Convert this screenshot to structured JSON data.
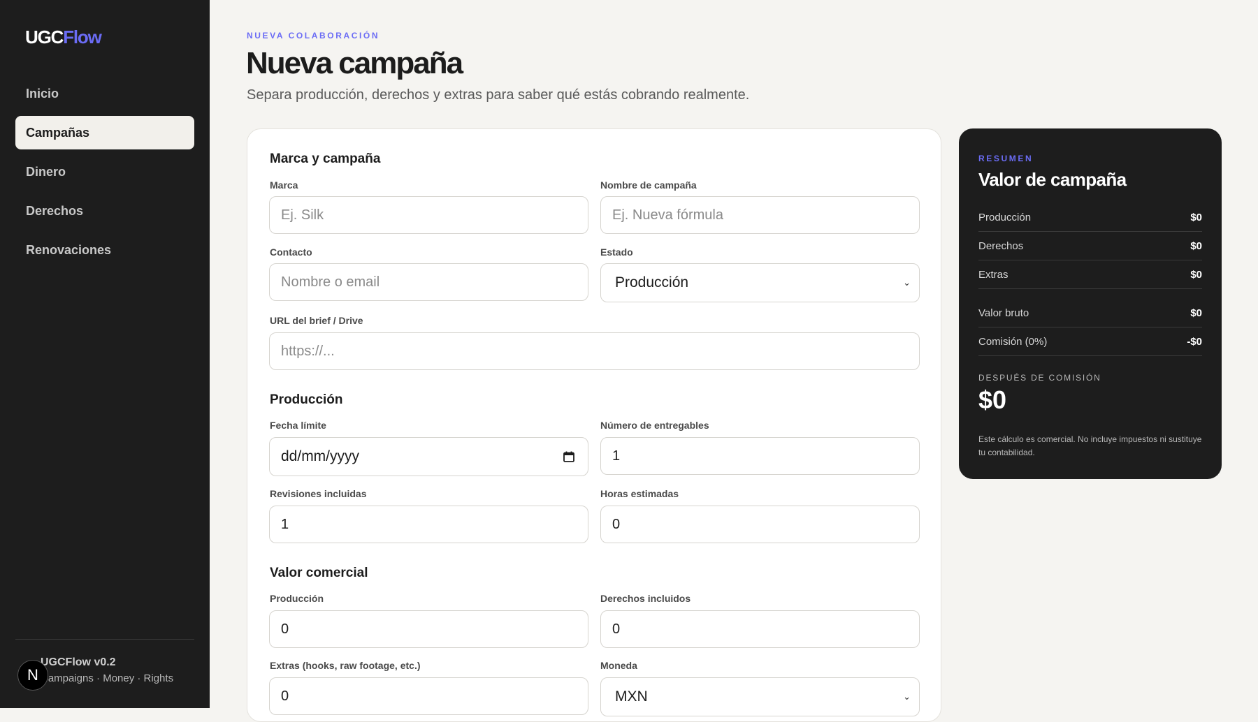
{
  "brand": {
    "part1": "UGC",
    "part2": "Flow"
  },
  "sidebar": {
    "items": [
      {
        "label": "Inicio"
      },
      {
        "label": "Campañas"
      },
      {
        "label": "Dinero"
      },
      {
        "label": "Derechos"
      },
      {
        "label": "Renovaciones"
      }
    ],
    "active_index": 1,
    "version": "UGCFlow v0.2",
    "tagline": "Campaigns · Money · Rights",
    "badge": "N"
  },
  "header": {
    "eyebrow": "NUEVA COLABORACIÓN",
    "title": "Nueva campaña",
    "subtitle": "Separa producción, derechos y extras para saber qué estás cobrando realmente."
  },
  "form": {
    "brand_section": {
      "title": "Marca y campaña",
      "marca": {
        "label": "Marca",
        "placeholder": "Ej. Silk",
        "value": ""
      },
      "nombre": {
        "label": "Nombre de campaña",
        "placeholder": "Ej. Nueva fórmula",
        "value": ""
      },
      "contacto": {
        "label": "Contacto",
        "placeholder": "Nombre o email",
        "value": ""
      },
      "estado": {
        "label": "Estado",
        "value": "Producción"
      },
      "url": {
        "label": "URL del brief / Drive",
        "placeholder": "https://...",
        "value": ""
      }
    },
    "production_section": {
      "title": "Producción",
      "fecha": {
        "label": "Fecha límite",
        "value": "dd/mm/yyyy"
      },
      "entregables": {
        "label": "Número de entregables",
        "value": "1"
      },
      "revisiones": {
        "label": "Revisiones incluidas",
        "value": "1"
      },
      "horas": {
        "label": "Horas estimadas",
        "value": "0"
      }
    },
    "value_section": {
      "title": "Valor comercial",
      "produccion": {
        "label": "Producción",
        "value": "0"
      },
      "derechos": {
        "label": "Derechos incluidos",
        "value": "0"
      },
      "extras": {
        "label": "Extras (hooks, raw footage, etc.)",
        "value": "0"
      },
      "moneda": {
        "label": "Moneda",
        "value": "MXN"
      }
    }
  },
  "summary": {
    "eyebrow": "RESUMEN",
    "title": "Valor de campaña",
    "rows": [
      {
        "label": "Producción",
        "value": "$0"
      },
      {
        "label": "Derechos",
        "value": "$0"
      },
      {
        "label": "Extras",
        "value": "$0"
      },
      {
        "label": "Valor bruto",
        "value": "$0"
      },
      {
        "label": "Comisión (0%)",
        "value": "-$0"
      }
    ],
    "after_label": "DESPUÉS DE COMISIÓN",
    "after_value": "$0",
    "note": "Este cálculo es comercial. No incluye impuestos ni sustituye tu contabilidad."
  },
  "colors": {
    "accent": "#6b6cf5",
    "sidebar": "#1d1d1d",
    "background": "#f5f4f1"
  }
}
